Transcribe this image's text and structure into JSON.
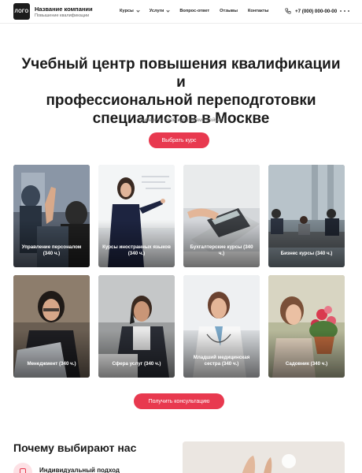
{
  "header": {
    "logo": "ЛОГО",
    "company_name": "Название компании",
    "company_tagline": "Повышение квалификации",
    "nav": [
      {
        "label": "Курсы",
        "has_dropdown": true
      },
      {
        "label": "Услуги",
        "has_dropdown": true
      },
      {
        "label": "Вопрос-ответ",
        "has_dropdown": false
      },
      {
        "label": "Отзывы",
        "has_dropdown": false
      },
      {
        "label": "Контакты",
        "has_dropdown": false
      }
    ],
    "phone": "+7 (000) 000-00-00"
  },
  "hero": {
    "title_line1": "Учебный центр повышения квалификации и",
    "title_line2": "профессиональной переподготовки",
    "title_line3": "специалистов в Москве",
    "subtitle": "Выберите свой курс прямо сейчас",
    "cta": "Выбрать курс"
  },
  "courses": [
    {
      "label": "Управление персоналом (340 ч.)"
    },
    {
      "label": "Курсы иностранных языков (340 ч.)"
    },
    {
      "label": "Бухгалтерские курсы (340 ч.)"
    },
    {
      "label": "Бизнес курсы (340 ч.)"
    },
    {
      "label": "Менеджмент (340 ч.)"
    },
    {
      "label": "Сфера услуг (340 ч.)"
    },
    {
      "label": "Младший медицинская сестра (340 ч.)"
    },
    {
      "label": "Садовник (340 ч.)"
    }
  ],
  "consult_button": "Получить консультацию",
  "why": {
    "title": "Почему выбирают нас",
    "feature_title": "Индивидуальный подход"
  },
  "colors": {
    "accent": "#e8394f",
    "dark": "#1c1c1c"
  }
}
